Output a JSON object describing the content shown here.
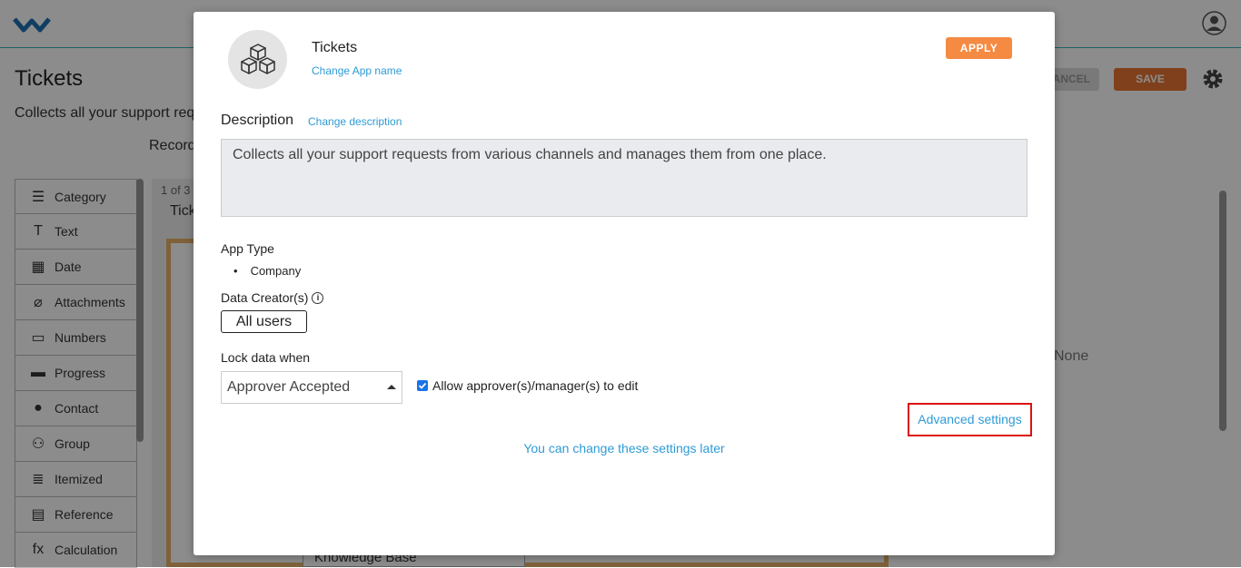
{
  "background": {
    "page_title": "Tickets",
    "page_subtitle": "Collects all your support requests from various channels and manages them from one place.",
    "records_label": "Records",
    "cancel_label": "CANCEL",
    "save_label": "SAVE",
    "canvas_count": "1 of 3",
    "canvas_name": "Tickets",
    "kb_field": "Knowledge Base",
    "rp_none": "None",
    "palette": [
      {
        "label": "Category",
        "icon": "list-icon",
        "glyph": "☰"
      },
      {
        "label": "Text",
        "icon": "text-icon",
        "glyph": "T"
      },
      {
        "label": "Date",
        "icon": "calendar-icon",
        "glyph": "▦"
      },
      {
        "label": "Attachments",
        "icon": "paperclip-icon",
        "glyph": "⌀"
      },
      {
        "label": "Numbers",
        "icon": "numbers-icon",
        "glyph": "▭"
      },
      {
        "label": "Progress",
        "icon": "progress-icon",
        "glyph": "▬"
      },
      {
        "label": "Contact",
        "icon": "contact-icon",
        "glyph": "●"
      },
      {
        "label": "Group",
        "icon": "group-icon",
        "glyph": "⚇"
      },
      {
        "label": "Itemized",
        "icon": "itemized-icon",
        "glyph": "≣"
      },
      {
        "label": "Reference",
        "icon": "document-icon",
        "glyph": "▤"
      },
      {
        "label": "Calculation",
        "icon": "function-icon",
        "glyph": "fx"
      }
    ]
  },
  "modal": {
    "app_name": "Tickets",
    "change_app_name": "Change App name",
    "apply_label": "APPLY",
    "description_label": "Description",
    "change_description": "Change description",
    "description_text": "Collects all your support requests from various channels and manages them from one place.",
    "app_type_label": "App Type",
    "app_type_value": "Company",
    "data_creator_label": "Data Creator(s)",
    "all_users_label": "All users",
    "lock_label": "Lock data when",
    "lock_value": "Approver Accepted",
    "allow_edit_label": "Allow approver(s)/manager(s) to edit",
    "allow_edit_checked": true,
    "advanced_settings": "Advanced settings",
    "change_later": "You can change these settings later"
  },
  "colors": {
    "accent_orange": "#f58a42",
    "link_blue": "#2e9bd6",
    "highlight_red": "#dd1111",
    "checkbox_blue": "#1a73e8"
  }
}
